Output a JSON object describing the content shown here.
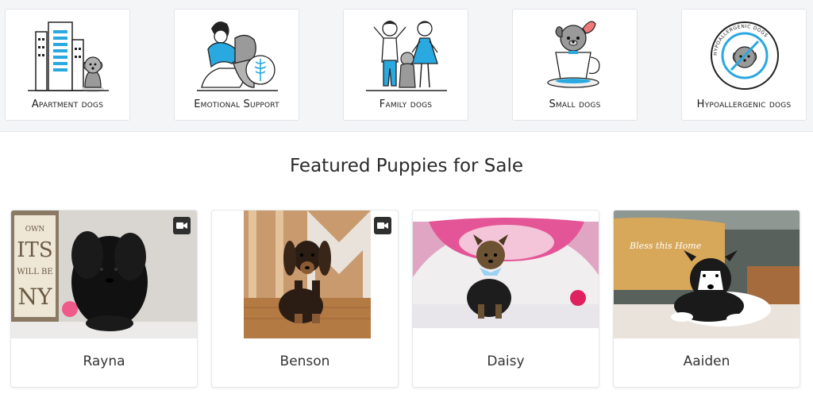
{
  "categories": [
    {
      "label": "Apartment dogs",
      "icon": "apartment-dog-icon"
    },
    {
      "label": "Emotional Support",
      "icon": "emotional-support-icon"
    },
    {
      "label": "Family dogs",
      "icon": "family-dog-icon"
    },
    {
      "label": "Small dogs",
      "icon": "small-dog-teacup-icon"
    },
    {
      "label": "Hypoallergenic dogs",
      "icon": "hypoallergenic-dog-icon"
    }
  ],
  "hypo_badge_text": "HYPOALLERGENIC DOGS",
  "featured": {
    "title": "Featured Puppies for Sale",
    "puppies": [
      {
        "name": "Rayna",
        "has_video": true,
        "backdrop_text": "OWN ITS WILL BE NY"
      },
      {
        "name": "Benson",
        "has_video": true
      },
      {
        "name": "Daisy",
        "has_video": false
      },
      {
        "name": "Aaiden",
        "has_video": false,
        "backdrop_text": "Bless this Home"
      }
    ]
  },
  "colors": {
    "accent_blue": "#2aa8e0",
    "strip_bg": "#f3f5f7",
    "video_badge": "#2f2f2f"
  }
}
